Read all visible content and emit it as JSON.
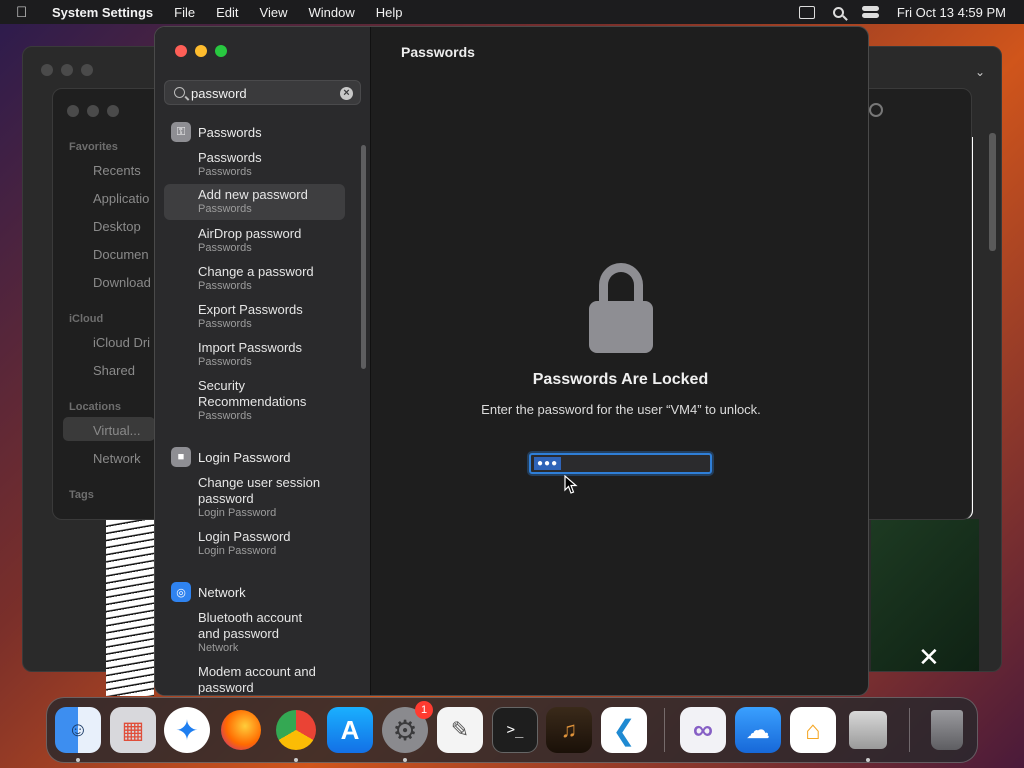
{
  "menubar": {
    "app_name": "System Settings",
    "menus": [
      "File",
      "Edit",
      "View",
      "Window",
      "Help"
    ],
    "clock": "Fri Oct 13  4:59 PM"
  },
  "finder": {
    "sections": [
      {
        "label": "Favorites",
        "items": [
          "Recents",
          "Applicatio",
          "Desktop",
          "Documen",
          "Download"
        ]
      },
      {
        "label": "iCloud",
        "items": [
          "iCloud Dri",
          "Shared"
        ]
      },
      {
        "label": "Locations",
        "items": [
          "Virtual...",
          "Network"
        ]
      },
      {
        "label": "Tags",
        "items": []
      }
    ]
  },
  "settings": {
    "search": {
      "value": "password"
    },
    "groups": [
      {
        "label": "Passwords",
        "icon": "key-icon",
        "items": [
          {
            "title": "Passwords",
            "sub": "Passwords"
          },
          {
            "title": "Add new password",
            "sub": "Passwords",
            "selected": true
          },
          {
            "title": "AirDrop password",
            "sub": "Passwords"
          },
          {
            "title": "Change a password",
            "sub": "Passwords"
          },
          {
            "title": "Export Passwords",
            "sub": "Passwords"
          },
          {
            "title": "Import Passwords",
            "sub": "Passwords"
          },
          {
            "title": "Security Recommendations",
            "sub": "Passwords"
          }
        ]
      },
      {
        "label": "Login Password",
        "icon": "lock-icon",
        "items": [
          {
            "title": "Change user session password",
            "sub": "Login Password"
          },
          {
            "title": "Login Password",
            "sub": "Login Password"
          }
        ]
      },
      {
        "label": "Network",
        "icon": "globe-icon",
        "items": [
          {
            "title": "Bluetooth account and password",
            "sub": "Network"
          },
          {
            "title": "Modem account and password",
            "sub": ""
          }
        ]
      }
    ],
    "content": {
      "title": "Passwords",
      "locked_title": "Passwords Are Locked",
      "locked_message": "Enter the password for the user “VM4” to unlock.",
      "password_mask": "●●●"
    }
  },
  "dock": {
    "apps": [
      "Finder",
      "Launchpad",
      "Safari",
      "Firefox",
      "Chrome",
      "App Store",
      "System Settings",
      "TextEdit",
      "Terminal",
      "GarageBand",
      "Visual Studio Code",
      "Visual Studio",
      "iCloud",
      "Home",
      "Installer",
      "Trash"
    ],
    "settings_badge": "1"
  }
}
